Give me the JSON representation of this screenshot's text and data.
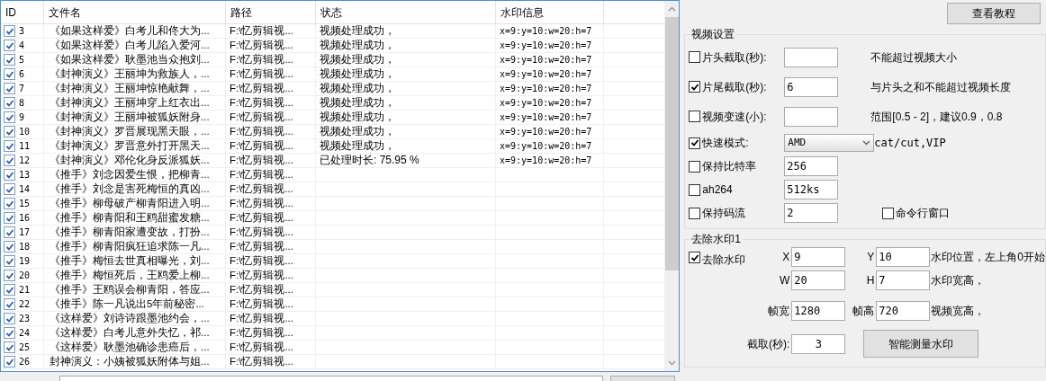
{
  "table": {
    "columns": [
      "ID",
      "文件名",
      "路径",
      "状态",
      "水印信息"
    ],
    "rows": [
      {
        "id": "3",
        "checked": true,
        "file_name": "《如果这样爱》白考儿和佟大为...",
        "path": "F:\\忆剪辑视...",
        "status": "视频处理成功，",
        "watermark_info": "x=9:y=10:w=20:h=7"
      },
      {
        "id": "4",
        "checked": true,
        "file_name": "《如果这样爱》白考儿陷入爱河...",
        "path": "F:\\忆剪辑视...",
        "status": "视频处理成功，",
        "watermark_info": "x=9:y=10:w=20:h=7"
      },
      {
        "id": "5",
        "checked": true,
        "file_name": "《如果这样爱》耿墨池当众抱刘...",
        "path": "F:\\忆剪辑视...",
        "status": "视频处理成功，",
        "watermark_info": "x=9:y=10:w=20:h=7"
      },
      {
        "id": "6",
        "checked": true,
        "file_name": "《封神演义》王丽坤为救族人，...",
        "path": "F:\\忆剪辑视...",
        "status": "视频处理成功，",
        "watermark_info": "x=9:y=10:w=20:h=7"
      },
      {
        "id": "7",
        "checked": true,
        "file_name": "《封神演义》王丽坤惊艳献舞，...",
        "path": "F:\\忆剪辑视...",
        "status": "视频处理成功，",
        "watermark_info": "x=9:y=10:w=20:h=7"
      },
      {
        "id": "8",
        "checked": true,
        "file_name": "《封神演义》王丽坤穿上红衣出...",
        "path": "F:\\忆剪辑视...",
        "status": "视频处理成功，",
        "watermark_info": "x=9:y=10:w=20:h=7"
      },
      {
        "id": "9",
        "checked": true,
        "file_name": "《封神演义》王丽坤被狐妖附身...",
        "path": "F:\\忆剪辑视...",
        "status": "视频处理成功，",
        "watermark_info": "x=9:y=10:w=20:h=7"
      },
      {
        "id": "10",
        "checked": true,
        "file_name": "《封神演义》罗晋展现黑天眼，...",
        "path": "F:\\忆剪辑视...",
        "status": "视频处理成功，",
        "watermark_info": "x=9:y=10:w=20:h=7"
      },
      {
        "id": "11",
        "checked": true,
        "file_name": "《封神演义》罗晋意外打开黑天...",
        "path": "F:\\忆剪辑视...",
        "status": "视频处理成功，",
        "watermark_info": "x=9:y=10:w=20:h=7"
      },
      {
        "id": "12",
        "checked": true,
        "file_name": "《封神演义》邓伦化身反派狐妖...",
        "path": "F:\\忆剪辑视...",
        "status": "已处理时长: 75.95 %",
        "watermark_info": "x=9:y=10:w=20:h=7"
      },
      {
        "id": "13",
        "checked": true,
        "file_name": "《推手》刘念因爱生恨，把柳青...",
        "path": "F:\\忆剪辑视..."
      },
      {
        "id": "14",
        "checked": true,
        "file_name": "《推手》刘念是害死梅恒的真凶...",
        "path": "F:\\忆剪辑视..."
      },
      {
        "id": "15",
        "checked": true,
        "file_name": "《推手》柳母破产柳青阳进入明...",
        "path": "F:\\忆剪辑视..."
      },
      {
        "id": "16",
        "checked": true,
        "file_name": "《推手》柳青阳和王鸥甜蜜发糖...",
        "path": "F:\\忆剪辑视..."
      },
      {
        "id": "17",
        "checked": true,
        "file_name": "《推手》柳青阳家遭变故，打扮...",
        "path": "F:\\忆剪辑视..."
      },
      {
        "id": "18",
        "checked": true,
        "file_name": "《推手》柳青阳疯狂追求陈一凡...",
        "path": "F:\\忆剪辑视..."
      },
      {
        "id": "19",
        "checked": true,
        "file_name": "《推手》梅恒去世真相曝光，刘...",
        "path": "F:\\忆剪辑视..."
      },
      {
        "id": "20",
        "checked": true,
        "file_name": "《推手》梅恒死后，王鸥爱上柳...",
        "path": "F:\\忆剪辑视..."
      },
      {
        "id": "21",
        "checked": true,
        "file_name": "《推手》王鸥误会柳青阳，答应...",
        "path": "F:\\忆剪辑视..."
      },
      {
        "id": "22",
        "checked": true,
        "file_name": "《推手》陈一凡说出5年前秘密...",
        "path": "F:\\忆剪辑视..."
      },
      {
        "id": "23",
        "checked": true,
        "file_name": "《这样爱》刘诗诗跟墨池约会，...",
        "path": "F:\\忆剪辑视..."
      },
      {
        "id": "24",
        "checked": true,
        "file_name": "《这样爱》白考儿意外失忆，祁...",
        "path": "F:\\忆剪辑视..."
      },
      {
        "id": "25",
        "checked": true,
        "file_name": "《这样爱》耿墨池确诊患癌后，...",
        "path": "F:\\忆剪辑视..."
      },
      {
        "id": "26",
        "checked": true,
        "file_name": "封神演义：小姨被狐妖附体与姐...",
        "path": "F:\\忆剪辑视..."
      }
    ]
  },
  "help_button": "查看教程",
  "video_settings": {
    "title": "视频设置",
    "options": [
      {
        "kind": "field",
        "label": "片头截取(秒):",
        "checked": false,
        "note": "不能超过视频大小"
      },
      {
        "kind": "field",
        "label": "片尾截取(秒):",
        "checked": true,
        "value": "6",
        "note": "与片头之和不能超过视频长度"
      },
      {
        "kind": "field",
        "label": "视频变速(小):",
        "checked": false,
        "note": "范围[0.5 - 2]，建议0.9，0.8"
      },
      {
        "kind": "select",
        "label": "快速模式:",
        "checked": true,
        "value": "AMD",
        "note": "cat/cut,VIP"
      },
      {
        "kind": "field",
        "label": "保持比特率",
        "checked": false,
        "value": "256"
      },
      {
        "kind": "field",
        "label": "ah264",
        "checked": false,
        "value": "512ks"
      },
      {
        "kind": "field",
        "label": "保持码流",
        "checked": false,
        "value": "2"
      }
    ],
    "command_window": {
      "label": "命令行窗口",
      "checked": false
    }
  },
  "watermark": {
    "title": "去除水印1",
    "remove": {
      "label": "去除水印",
      "checked": true
    },
    "rows": [
      {
        "fields": [
          {
            "label": "X",
            "value": "9"
          },
          {
            "label": "Y",
            "value": "10"
          }
        ],
        "note": "水印位置，左上角0开始"
      },
      {
        "fields": [
          {
            "label": "W",
            "value": "20"
          },
          {
            "label": "H",
            "value": "7"
          }
        ],
        "note": "水印宽高，"
      },
      {
        "fields": [
          {
            "label": "帧宽",
            "value": "1280"
          },
          {
            "label": "帧高",
            "value": "720"
          }
        ],
        "note": "视频宽高，"
      }
    ],
    "capture": {
      "label": "截取(秒):",
      "value": "3"
    },
    "measure_button": "智能测量水印"
  }
}
